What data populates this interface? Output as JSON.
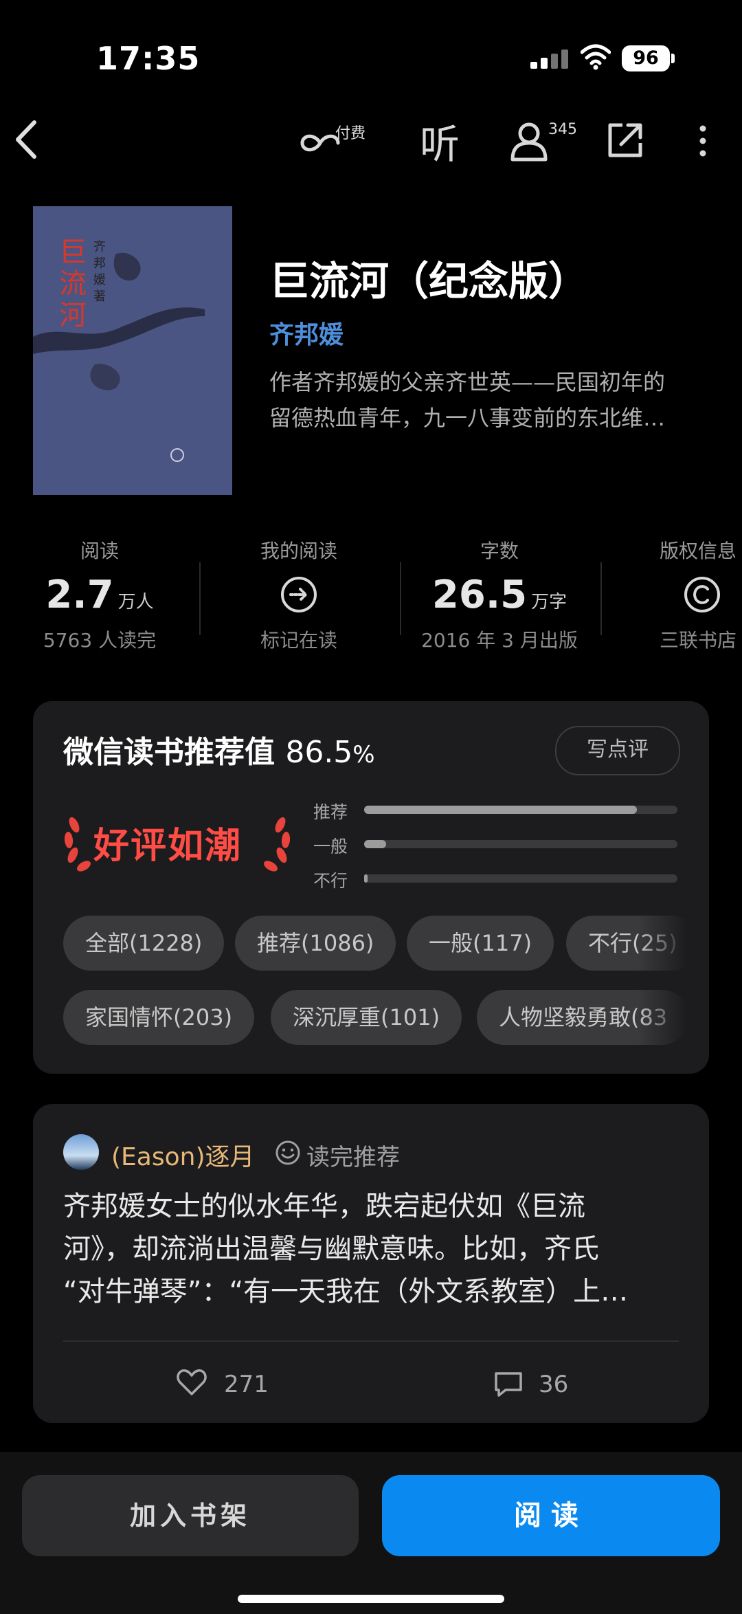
{
  "status": {
    "time": "17:35",
    "battery": "96"
  },
  "nav": {
    "back_icon": "chevron-left-icon",
    "paid_label": "付费",
    "listen_label": "听",
    "readers_count": "345"
  },
  "book": {
    "cover_title": "巨流河",
    "cover_author": "齐邦媛 著",
    "title": "巨流河（纪念版）",
    "author": "齐邦媛",
    "description_line1": "作者齐邦媛的父亲齐世英——民国初年的",
    "description_line2": "留德热血青年，九一八事变前的东北维…"
  },
  "stats": {
    "reading": {
      "label": "阅读",
      "value": "2.7",
      "unit": "万人",
      "sub": "5763 人读完"
    },
    "my_reading": {
      "label": "我的阅读",
      "sub": "标记在读"
    },
    "words": {
      "label": "字数",
      "value": "26.5",
      "unit": "万字",
      "sub": "2016 年 3 月出版"
    },
    "copyright": {
      "label": "版权信息",
      "sub": "三联书店"
    }
  },
  "rating": {
    "title": "微信读书推荐值",
    "value": "86.5",
    "percent_sign": "%",
    "write_button": "写点评",
    "badge": "好评如潮",
    "bars": [
      {
        "label": "推荐",
        "fraction": 0.87
      },
      {
        "label": "一般",
        "fraction": 0.07
      },
      {
        "label": "不行",
        "fraction": 0.012
      }
    ],
    "chips_row1": [
      "全部(1228)",
      "推荐(1086)",
      "一般(117)",
      "不行(25)"
    ],
    "chips_row2": [
      "家国情怀(203)",
      "深沉厚重(101)",
      "人物坚毅勇敢(83"
    ]
  },
  "review": {
    "reviewer": "(Eason)逐月",
    "tag": "读完推荐",
    "text_line1": "齐邦媛女士的似水年华，跌宕起伏如《巨流",
    "text_line2": "河》，却流淌出温馨与幽默意味。比如，齐氏",
    "text_line3": "“对牛弹琴”：“有一天我在（外文系教室）上…",
    "likes": "271",
    "comments": "36"
  },
  "bottom": {
    "shelf_label": "加入书架",
    "read_label": "阅读"
  },
  "colors": {
    "accent_blue": "#0a8af0",
    "author_blue": "#4d8fdb",
    "badge_red": "#ff4d45",
    "reviewer_gold": "#e8b878"
  }
}
